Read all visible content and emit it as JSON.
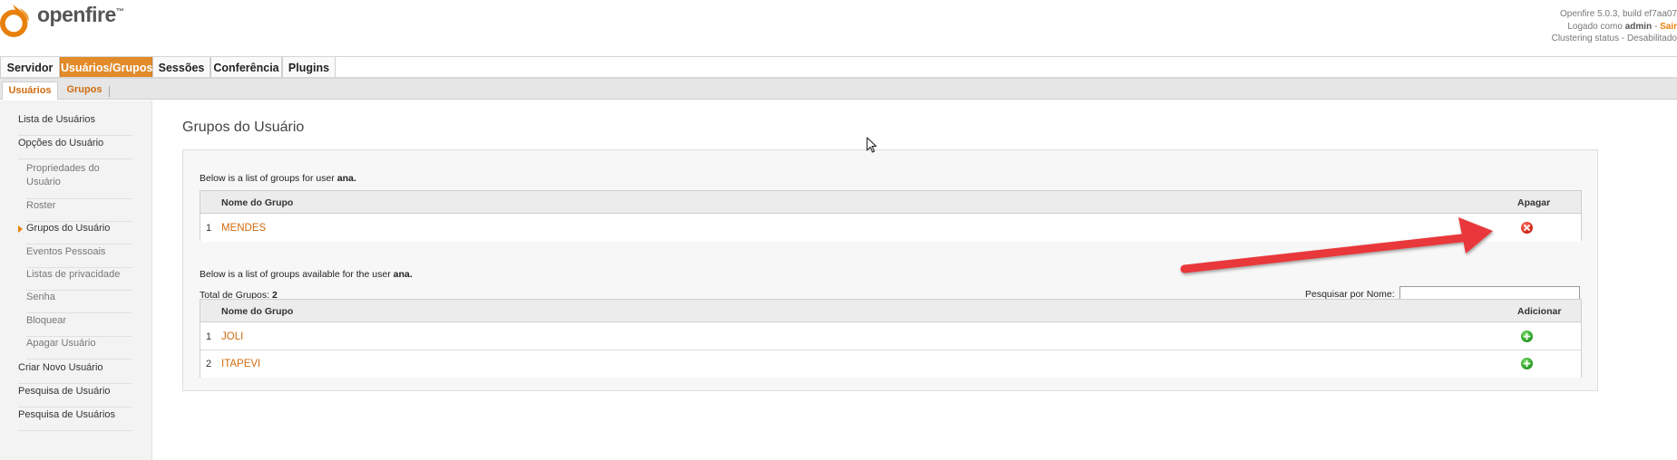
{
  "header": {
    "logo_text": "openfire",
    "logo_tm": "™",
    "version": "Openfire 5.0.3, build ef7aa07",
    "logged_prefix": "Logado como",
    "logged_user": "admin",
    "logged_sep": "-",
    "logout_label": "Sair",
    "clustering": "Clustering status - Desabilitado"
  },
  "mainnav": {
    "tabs": [
      {
        "label": "Servidor",
        "active": false
      },
      {
        "label": "Usuários/Grupos",
        "active": true
      },
      {
        "label": "Sessões",
        "active": false
      },
      {
        "label": "Conferência",
        "active": false
      },
      {
        "label": "Plugins",
        "active": false
      }
    ]
  },
  "subnav": {
    "tabs": [
      {
        "label": "Usuários",
        "active": true
      },
      {
        "label": "Grupos",
        "active": false
      }
    ]
  },
  "sidebar": {
    "items": [
      {
        "label": "Lista de Usuários"
      },
      {
        "label": "Opções do Usuário"
      },
      {
        "label": "Propriedades do Usuário"
      },
      {
        "label": "Roster"
      },
      {
        "label": "Grupos do Usuário"
      },
      {
        "label": "Eventos Pessoais"
      },
      {
        "label": "Listas de privacidade"
      },
      {
        "label": "Senha"
      },
      {
        "label": "Bloquear"
      },
      {
        "label": "Apagar Usuário"
      },
      {
        "label": "Criar Novo Usuário"
      },
      {
        "label": "Pesquisa de Usuário"
      },
      {
        "label": "Pesquisa de Usuários"
      }
    ]
  },
  "main": {
    "page_title": "Grupos do Usuário",
    "member_intro": "Below is a list of groups for user",
    "member_user": "ana.",
    "member_table": {
      "col_name": "Nome do Grupo",
      "col_action": "Apagar",
      "rows": [
        {
          "num": "1",
          "name": "MENDES",
          "action_icon": "delete-icon"
        }
      ]
    },
    "available_intro": "Below is a list of groups available for the user",
    "available_user": "ana.",
    "total_label": "Total de Grupos:",
    "total_value": "2",
    "search_label": "Pesquisar por Nome:",
    "search_value": "",
    "available_table": {
      "col_name": "Nome do Grupo",
      "col_action": "Adicionar",
      "rows": [
        {
          "num": "1",
          "name": "JOLI",
          "action_icon": "add-icon"
        },
        {
          "num": "2",
          "name": "ITAPEVI",
          "action_icon": "add-icon"
        }
      ]
    }
  },
  "colors": {
    "accent": "#e28b2a",
    "link": "#d06b10",
    "annotation_arrow": "#e8383b"
  }
}
